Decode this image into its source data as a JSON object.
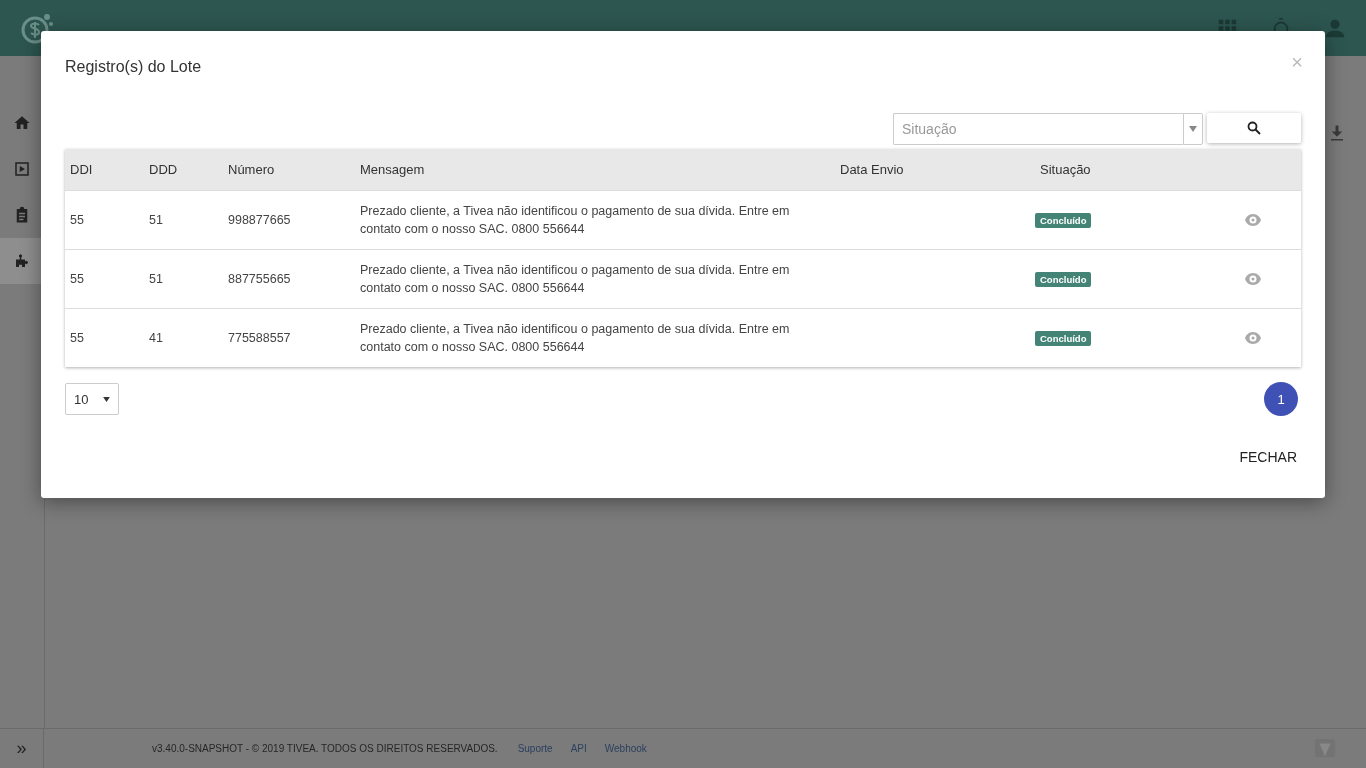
{
  "sidebar": {
    "items": [
      {
        "selected": false
      },
      {
        "selected": false
      },
      {
        "selected": false
      },
      {
        "selected": true
      }
    ]
  },
  "footer": {
    "expand": "»",
    "copyright": "v3.40.0-SNAPSHOT - © 2019 TIVEA. TODOS OS DIREITOS RESERVADOS.",
    "links": [
      "Suporte",
      "API",
      "Webhook"
    ]
  },
  "modal": {
    "title": "Registro(s) do Lote",
    "close": "×",
    "filter": {
      "placeholder": "Situação"
    },
    "table": {
      "columns": [
        "DDI",
        "DDD",
        "Número",
        "Mensagem",
        "Data Envio",
        "Situação"
      ],
      "rows": [
        {
          "ddi": "55",
          "ddd": "51",
          "numero": "998877665",
          "mensagem": "Prezado cliente, a Tivea não identificou o pagamento de sua dívida. Entre em contato com o nosso SAC. 0800 556644",
          "situacao": "Concluído"
        },
        {
          "ddi": "55",
          "ddd": "51",
          "numero": "887755665",
          "mensagem": "Prezado cliente, a Tivea não identificou o pagamento de sua dívida. Entre em contato com o nosso SAC. 0800 556644",
          "situacao": "Concluído"
        },
        {
          "ddi": "55",
          "ddd": "41",
          "numero": "775588557",
          "mensagem": "Prezado cliente, a Tivea não identificou o pagamento de sua dívida. Entre em contato com o nosso SAC. 0800 556644",
          "situacao": "Concluído"
        }
      ]
    },
    "page_size": "10",
    "pages": [
      {
        "label": "1",
        "selected": true
      }
    ],
    "close_button": "FECHAR"
  }
}
